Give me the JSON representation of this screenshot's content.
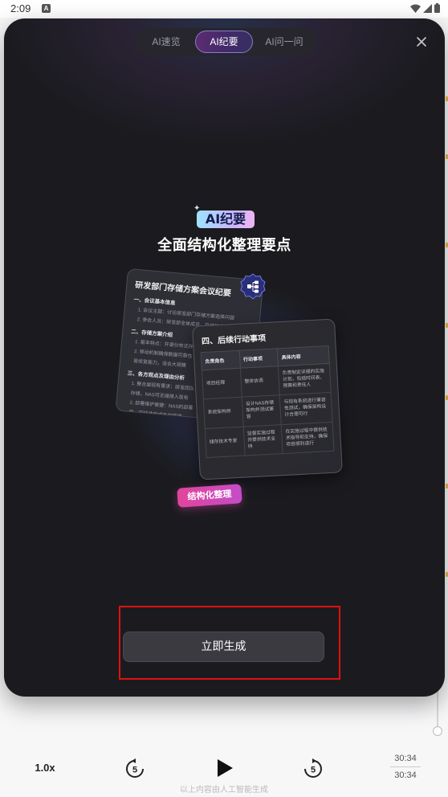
{
  "status_bar": {
    "time": "2:09",
    "app_icon": "A"
  },
  "modal": {
    "tabs": [
      {
        "label": "AI速览",
        "active": false
      },
      {
        "label": "AI纪要",
        "active": true
      },
      {
        "label": "AI问一问",
        "active": false
      }
    ],
    "hero": {
      "badge": "AI纪要",
      "title": "全面结构化整理要点"
    },
    "illustration": {
      "back_card": {
        "title": "研发部门存储方案会议纪要",
        "lines": [
          {
            "kind": "h",
            "text": "一、会议基本信息"
          },
          {
            "kind": "i",
            "text": "1. 会议主题：讨论研发部门存储方案选择问题"
          },
          {
            "kind": "i",
            "text": "2. 参会人员：研发部全体成员、存储技术专家"
          },
          {
            "kind": "h",
            "text": "二、存储方案介绍"
          },
          {
            "kind": "i",
            "text": "1. 基本特点：开源分布式存储方案"
          },
          {
            "kind": "i",
            "text": "2. 移动机制确保数据可靠性"
          },
          {
            "kind": "i",
            "text": "  易修复能力，适合大规模"
          },
          {
            "kind": "h",
            "text": "三、各方观点及理由分析"
          },
          {
            "kind": "i",
            "text": "1. 聚合层现有需求：研发团队"
          },
          {
            "kind": "i",
            "text": "  存储，NAS可无缝接入现有"
          },
          {
            "kind": "i",
            "text": "2. 部署维护便捷：NAS的部署"
          },
          {
            "kind": "i",
            "text": "  简，可快速完成系统搭建"
          }
        ]
      },
      "front_card": {
        "title": "四、后续行动事项",
        "headers": [
          "负责角色",
          "行动事项",
          "具体内容"
        ],
        "rows": [
          [
            "项目经理",
            "整体协调",
            "负责制定详细的实施计划，包括时间表、预算和责任人"
          ],
          [
            "系统架构师",
            "设计NAS存储架构并测试兼容",
            "与现有系统进行兼容性测试，确保架构设计合理可行"
          ],
          [
            "储存技术专家",
            "监督实施过程并提供技术支持",
            "在实施过程中提供技术指导和支持，确保项目顺利进行"
          ]
        ]
      },
      "tag": "结构化整理"
    },
    "generate_button": "立即生成"
  },
  "player": {
    "speed": "1.0x",
    "skip_back_seconds": "5",
    "skip_forward_seconds": "5",
    "current_time": "30:34",
    "total_time": "30:34",
    "ai_note": "以上内容由人工智能生成"
  },
  "icons": {
    "close": "close-icon",
    "play": "play-icon",
    "skip_back": "rewind-5-icon",
    "skip_forward": "forward-5-icon",
    "org_chart": "org-chart-icon"
  },
  "colors": {
    "modal_bg": "#1b1b1f",
    "active_tab_border": "#8a7bd0",
    "tag_gradient_start": "#e0459b",
    "highlight": "#e01010"
  }
}
